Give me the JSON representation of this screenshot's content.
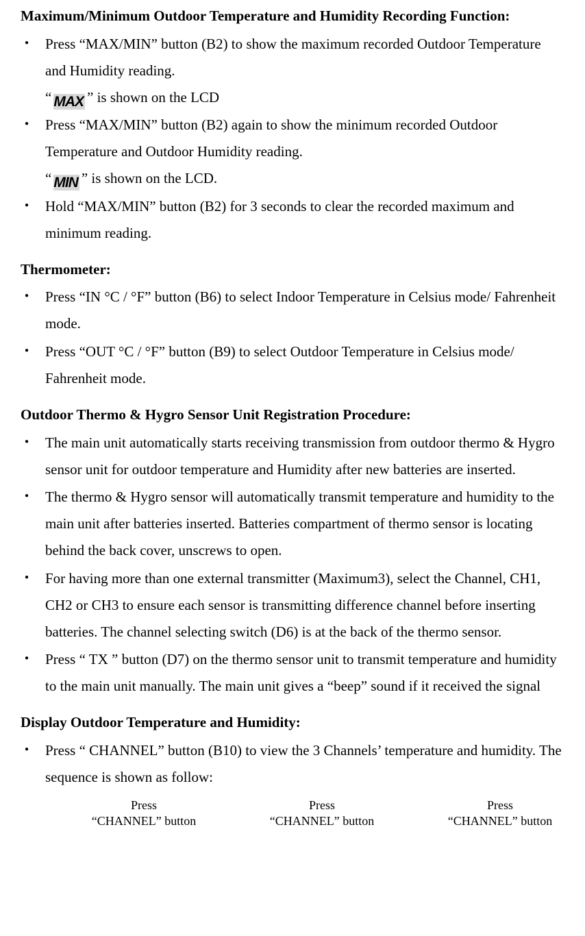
{
  "sections": [
    {
      "title": "Maximum/Minimum Outdoor Temperature and Humidity Recording Function:",
      "items": [
        {
          "lines": [
            "Press \"MAX/MIN\" button (B2) to show the maximum recorded Outdoor Temperature and Humidity reading.",
            "\"{MAX}\" is shown on the LCD"
          ]
        },
        {
          "lines": [
            "Press \"MAX/MIN\" button (B2) again to show the minimum recorded Outdoor Temperature and Outdoor Humidity reading.",
            "\"{MIN}\" is shown on the LCD."
          ]
        },
        {
          "lines": [
            "Hold \"MAX/MIN\" button (B2) for 3 seconds to clear the recorded maximum and minimum reading."
          ]
        }
      ]
    },
    {
      "title": "Thermometer:",
      "items": [
        {
          "lines": [
            "Press \"IN °C / °F\" button (B6) to select Indoor Temperature in Celsius mode/ Fahrenheit mode."
          ]
        },
        {
          "lines": [
            "Press \"OUT °C / °F\" button (B9) to select Outdoor Temperature in Celsius mode/ Fahrenheit mode."
          ]
        }
      ]
    },
    {
      "title": "Outdoor Thermo & Hygro Sensor Unit Registration Procedure:",
      "items": [
        {
          "lines": [
            "The main unit automatically starts receiving transmission from outdoor thermo & Hygro sensor unit for outdoor temperature and Humidity after new batteries are inserted."
          ]
        },
        {
          "lines": [
            "The thermo & Hygro sensor will automatically transmit temperature and humidity to the main unit after batteries inserted. Batteries compartment of thermo sensor is locating behind the back cover, unscrews to open."
          ]
        },
        {
          "lines": [
            "For having more than one external transmitter (Maximum3), select the Channel, CH1, CH2 or CH3 to ensure each sensor is transmitting difference channel before inserting batteries. The channel selecting switch (D6) is at the back of the thermo sensor."
          ]
        },
        {
          "lines": [
            "Press \" TX \" button (D7) on the thermo sensor unit to transmit temperature and humidity to the main unit manually. The main unit gives a \"beep\" sound if it received the signal"
          ]
        }
      ]
    },
    {
      "title": "Display Outdoor Temperature and Humidity:",
      "items": [
        {
          "lines": [
            "Press \" CHANNEL\" button (B10) to view the 3 Channels' temperature and humidity. The sequence is shown as follow:"
          ]
        }
      ]
    }
  ],
  "lcd_max": "MAX",
  "lcd_min": "MIN",
  "channel_top": "Press",
  "channel_bottom": "\"CHANNEL\" button"
}
